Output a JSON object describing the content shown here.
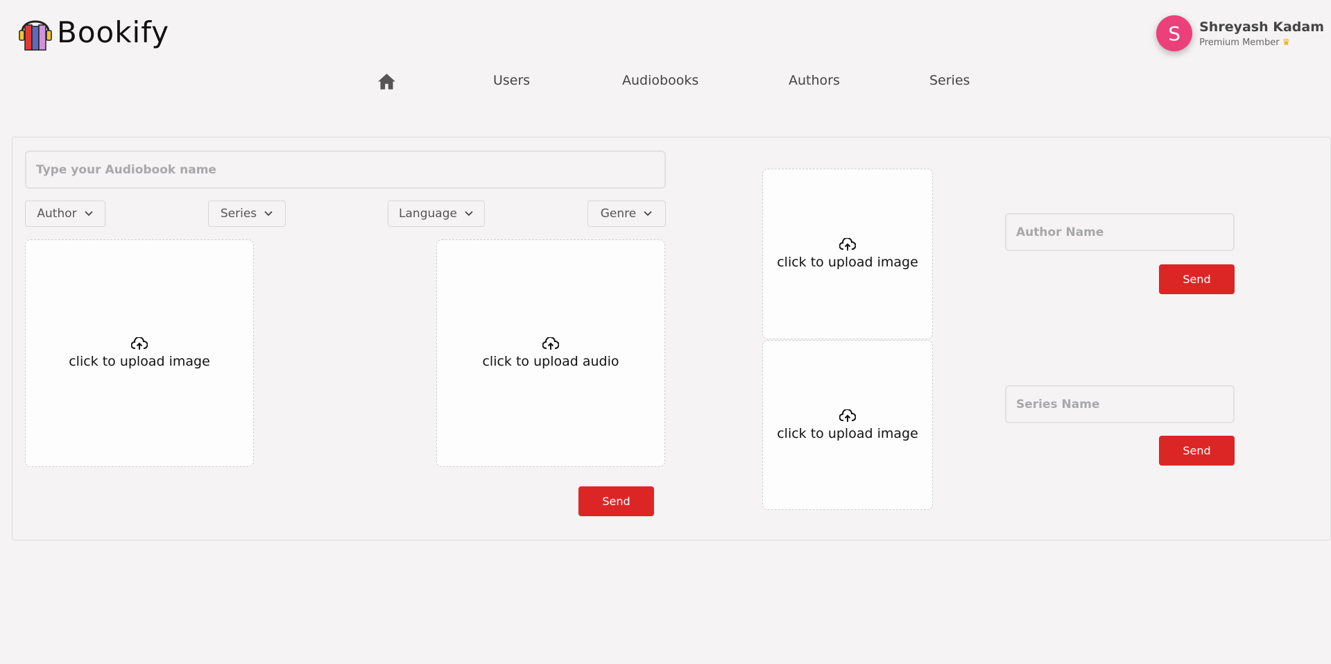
{
  "brand": {
    "name": "Bookify"
  },
  "profile": {
    "initial": "S",
    "name": "Shreyash Kadam",
    "subtitle": "Premium Member"
  },
  "nav": {
    "home_icon": "home-icon",
    "items": [
      "Users",
      "Audiobooks",
      "Authors",
      "Series"
    ]
  },
  "audiobook_form": {
    "name_placeholder": "Type your Audiobook name",
    "dropdowns": [
      "Author",
      "Series",
      "Language",
      "Genre"
    ],
    "upload_image_label": "click to upload image",
    "upload_audio_label": "click to upload audio",
    "send_label": "Send"
  },
  "media_uploads": {
    "top_label": "click to upload image",
    "bottom_label": "click to upload image"
  },
  "author_form": {
    "name_placeholder": "Author Name",
    "send_label": "Send"
  },
  "series_form": {
    "name_placeholder": "Series Name",
    "send_label": "Send"
  },
  "colors": {
    "accent": "#dc2626",
    "avatar": "#ec407a",
    "background": "#f5f3f4"
  }
}
